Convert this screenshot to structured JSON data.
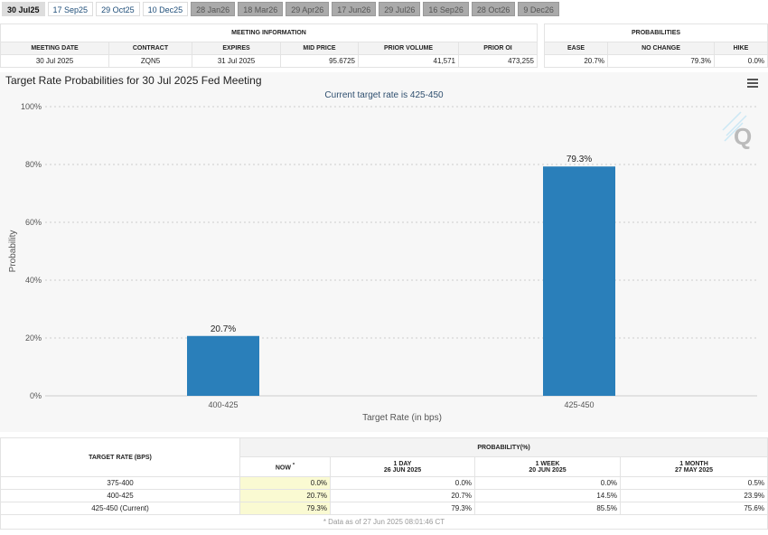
{
  "tabs": [
    {
      "label": "30 Jul25",
      "state": "active"
    },
    {
      "label": "17 Sep25",
      "state": "normal"
    },
    {
      "label": "29 Oct25",
      "state": "normal"
    },
    {
      "label": "10 Dec25",
      "state": "normal"
    },
    {
      "label": "28 Jan26",
      "state": "disabled"
    },
    {
      "label": "18 Mar26",
      "state": "disabled"
    },
    {
      "label": "29 Apr26",
      "state": "disabled"
    },
    {
      "label": "17 Jun26",
      "state": "disabled"
    },
    {
      "label": "29 Jul26",
      "state": "disabled"
    },
    {
      "label": "16 Sep26",
      "state": "disabled"
    },
    {
      "label": "28 Oct26",
      "state": "disabled"
    },
    {
      "label": "9 Dec26",
      "state": "disabled"
    }
  ],
  "meeting": {
    "title": "MEETING INFORMATION",
    "headers": [
      "MEETING DATE",
      "CONTRACT",
      "EXPIRES",
      "MID PRICE",
      "PRIOR VOLUME",
      "PRIOR OI"
    ],
    "values": [
      "30 Jul 2025",
      "ZQN5",
      "31 Jul 2025",
      "95.6725",
      "41,571",
      "473,255"
    ]
  },
  "probabilities": {
    "title": "PROBABILITIES",
    "headers": [
      "EASE",
      "NO CHANGE",
      "HIKE"
    ],
    "values": [
      "20.7%",
      "79.3%",
      "0.0%"
    ]
  },
  "chart_data": {
    "type": "bar",
    "title": "Target Rate Probabilities for 30 Jul 2025 Fed Meeting",
    "subtitle": "Current target rate is 425-450",
    "xlabel": "Target Rate (in bps)",
    "ylabel": "Probability",
    "categories": [
      "400-425",
      "425-450"
    ],
    "values": [
      20.7,
      79.3
    ],
    "data_labels": [
      "20.7%",
      "79.3%"
    ],
    "ylim": [
      0,
      100
    ],
    "yticks": [
      "0%",
      "20%",
      "40%",
      "60%",
      "80%",
      "100%"
    ],
    "grid": true,
    "color": "#2a7fba"
  },
  "table": {
    "rate_header": "TARGET RATE (BPS)",
    "prob_header": "PROBABILITY(%)",
    "cols": [
      {
        "l1": "NOW",
        "l2": "*"
      },
      {
        "l1": "1 DAY",
        "l2": "26 JUN 2025"
      },
      {
        "l1": "1 WEEK",
        "l2": "20 JUN 2025"
      },
      {
        "l1": "1 MONTH",
        "l2": "27 MAY 2025"
      }
    ],
    "rows": [
      {
        "rate": "375-400",
        "v": [
          "0.0%",
          "0.0%",
          "0.0%",
          "0.5%"
        ]
      },
      {
        "rate": "400-425",
        "v": [
          "20.7%",
          "20.7%",
          "14.5%",
          "23.9%"
        ]
      },
      {
        "rate": "425-450 (Current)",
        "v": [
          "79.3%",
          "79.3%",
          "85.5%",
          "75.6%"
        ]
      }
    ],
    "footnote": "* Data as of 27 Jun 2025 08:01:46 CT"
  }
}
